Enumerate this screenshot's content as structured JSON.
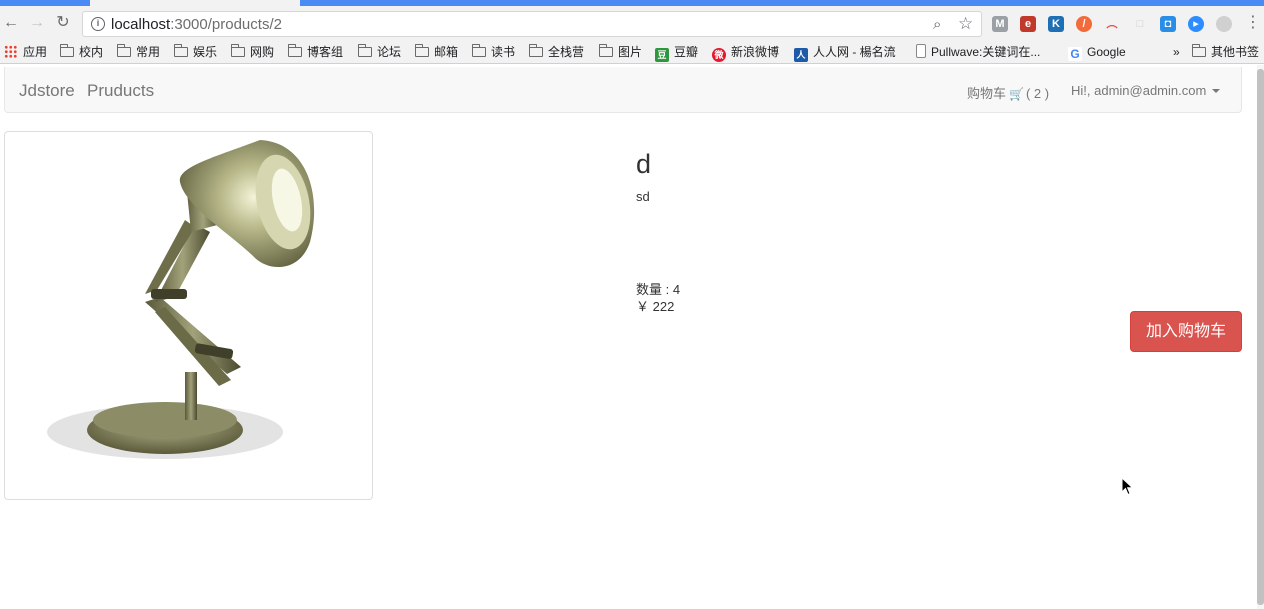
{
  "browser": {
    "url_host": "localhost",
    "url_path": ":3000/products/2",
    "bookmarks": [
      {
        "label": "应用",
        "icon": "apps-grid-icon"
      },
      {
        "label": "校内",
        "icon": "folder-icon"
      },
      {
        "label": "常用",
        "icon": "folder-icon"
      },
      {
        "label": "娱乐",
        "icon": "folder-icon"
      },
      {
        "label": "网购",
        "icon": "folder-icon"
      },
      {
        "label": "博客组",
        "icon": "folder-icon"
      },
      {
        "label": "论坛",
        "icon": "folder-icon"
      },
      {
        "label": "邮箱",
        "icon": "folder-icon"
      },
      {
        "label": "读书",
        "icon": "folder-icon"
      },
      {
        "label": "全栈营",
        "icon": "folder-icon"
      },
      {
        "label": "图片",
        "icon": "folder-icon"
      },
      {
        "label": "豆瓣",
        "icon": "douban-icon"
      },
      {
        "label": "新浪微博",
        "icon": "weibo-icon"
      },
      {
        "label": "人人网 - 楊名流",
        "icon": "renren-icon"
      },
      {
        "label": "Pullwave:关键词在...",
        "icon": "page-icon"
      },
      {
        "label": "Google",
        "icon": "google-icon"
      },
      {
        "label": "»",
        "icon": "overflow-icon"
      },
      {
        "label": "其他书签",
        "icon": "folder-icon"
      }
    ]
  },
  "navbar": {
    "brand": "Jdstore",
    "link": "Pruducts",
    "cart_label": "购物车",
    "cart_count": "( 2 )",
    "user_label": "Hi!, admin@admin.com"
  },
  "product": {
    "title": "d",
    "description": "sd",
    "quantity": "数量 : 4",
    "price": "￥ 222",
    "add_to_cart": "加入购物车"
  },
  "colors": {
    "accent": "#4a8af4",
    "danger": "#d9534f"
  }
}
